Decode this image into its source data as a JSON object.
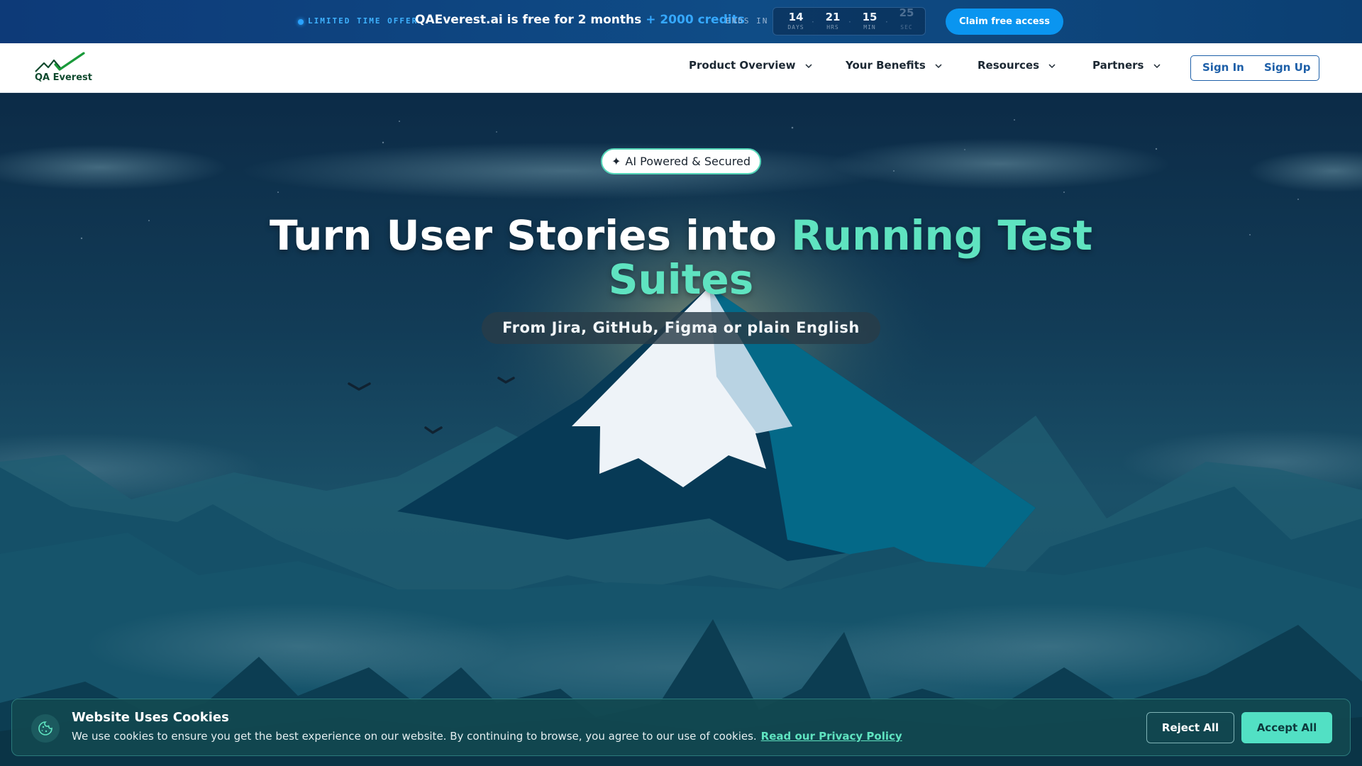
{
  "promo": {
    "tag": "LIMITED TIME OFFER",
    "headline": "QAEverest.ai is free for 2 months",
    "credits": "+ 2000 credits",
    "ends_label": "ENDS IN",
    "countdown": [
      {
        "value": "14",
        "unit": "DAYS"
      },
      {
        "value": "21",
        "unit": "HRS"
      },
      {
        "value": "15",
        "unit": "MIN"
      },
      {
        "value": "25",
        "unit": "SEC"
      }
    ],
    "cta": "Claim free access"
  },
  "nav": {
    "logo_text": "QA Everest",
    "items": [
      {
        "label": "Product Overview"
      },
      {
        "label": "Your Benefits"
      },
      {
        "label": "Resources"
      },
      {
        "label": "Partners"
      }
    ],
    "sign_in": "Sign In",
    "sign_up": "Sign Up"
  },
  "hero": {
    "badge": "AI Powered & Secured",
    "badge_icon": "sparkle-icon",
    "headline_main": "Turn User Stories into",
    "headline_accent": "Running Test Suites",
    "subline": "From Jira, GitHub, Figma or plain English"
  },
  "cookie": {
    "title": "Website Uses Cookies",
    "body": "We use cookies to ensure you get the best experience on our website. By continuing to browse, you agree to our use of cookies.",
    "link": "Read our Privacy Policy",
    "reject": "Reject All",
    "accept": "Accept All"
  },
  "colors": {
    "banner_bg": "#0d3a78",
    "accent_blue": "#0a95f0",
    "accent_teal": "#5fe3c0",
    "nav_link": "#1d5fa8"
  }
}
